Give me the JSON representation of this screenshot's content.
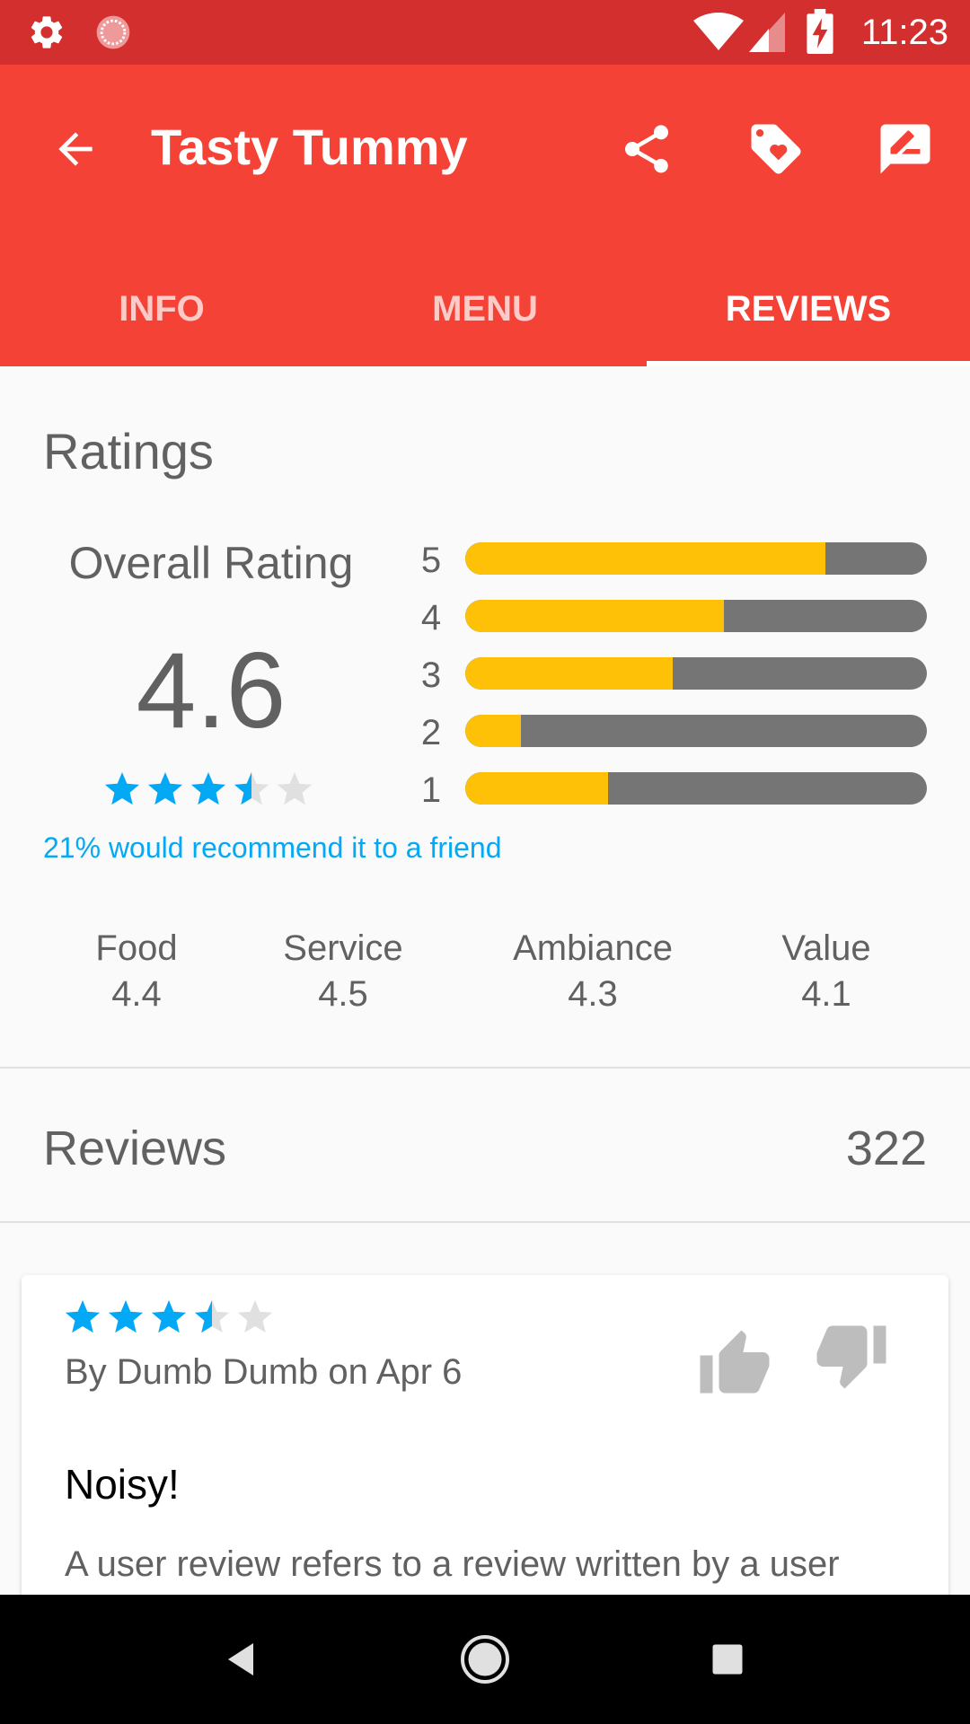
{
  "status_bar": {
    "time": "11:23",
    "icons": [
      "gear-icon",
      "loading-icon",
      "wifi-icon",
      "signal-icon",
      "battery-charging-icon"
    ]
  },
  "app_bar": {
    "title": "Tasty Tummy",
    "back_icon": "arrow-left-icon",
    "actions": [
      "share-icon",
      "tag-heart-icon",
      "rate-review-icon"
    ],
    "colors": {
      "status": "#d32f2f",
      "bar": "#f44336"
    }
  },
  "tabs": [
    {
      "label": "INFO",
      "active": false
    },
    {
      "label": "MENU",
      "active": false
    },
    {
      "label": "REVIEWS",
      "active": true
    }
  ],
  "ratings": {
    "heading": "Ratings",
    "overall_label": "Overall Rating",
    "overall_value": "4.6",
    "overall_stars": 3.5,
    "recommend_text": "21% would recommend it to a friend",
    "distribution": [
      {
        "stars": "5",
        "fraction": 0.78
      },
      {
        "stars": "4",
        "fraction": 0.56
      },
      {
        "stars": "3",
        "fraction": 0.45
      },
      {
        "stars": "2",
        "fraction": 0.12
      },
      {
        "stars": "1",
        "fraction": 0.31
      }
    ],
    "bar_colors": {
      "fill": "#ffc107",
      "track": "#757575"
    },
    "star_color": "#03a9f4",
    "subratings": [
      {
        "label": "Food",
        "value": "4.4"
      },
      {
        "label": "Service",
        "value": "4.5"
      },
      {
        "label": "Ambiance",
        "value": "4.3"
      },
      {
        "label": "Value",
        "value": "4.1"
      }
    ]
  },
  "reviews": {
    "label": "Reviews",
    "count": "322",
    "items": [
      {
        "stars": 3.5,
        "byline": "By Dumb Dumb on Apr 6",
        "title": "Noisy!",
        "body": "A user review refers to a review written by a user"
      }
    ]
  },
  "nav_bar": {
    "icons": [
      "nav-back-icon",
      "nav-home-icon",
      "nav-recents-icon"
    ]
  }
}
